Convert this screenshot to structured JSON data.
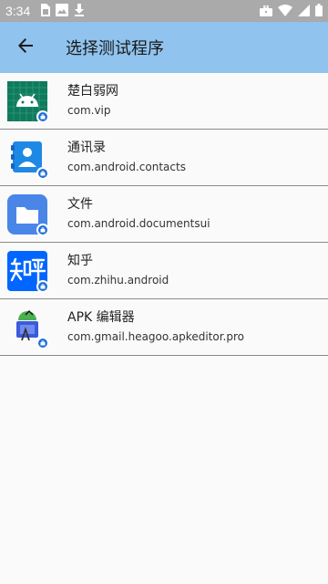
{
  "status_bar": {
    "time": "3:34",
    "left_icons": [
      "sim-icon",
      "image-icon",
      "download-icon"
    ],
    "right_icons": [
      "briefcase-icon",
      "wifi-icon",
      "signal-icon",
      "battery-icon"
    ]
  },
  "app_bar": {
    "title": "选择测试程序",
    "back_icon": "arrow-back-icon",
    "background": "#90c3ee"
  },
  "apps": [
    {
      "name": "楚白弱网",
      "package": "com.vip",
      "icon": "android-grid-icon",
      "icon_color": "#0f7a5c"
    },
    {
      "name": "通讯录",
      "package": "com.android.contacts",
      "icon": "contacts-icon",
      "icon_color": "#1e88e5"
    },
    {
      "name": "文件",
      "package": "com.android.documentsui",
      "icon": "folder-icon",
      "icon_color": "#4a86e8"
    },
    {
      "name": "知乎",
      "package": "com.zhihu.android",
      "icon": "zhihu-icon",
      "icon_color": "#0066ff"
    },
    {
      "name": "APK 编辑器",
      "package": "com.gmail.heagoo.apkeditor.pro",
      "icon": "apk-editor-icon",
      "icon_color": "#3b5bdb"
    }
  ],
  "colors": {
    "work_badge": "#1e6fd9",
    "divider": "#8a8a8a"
  }
}
